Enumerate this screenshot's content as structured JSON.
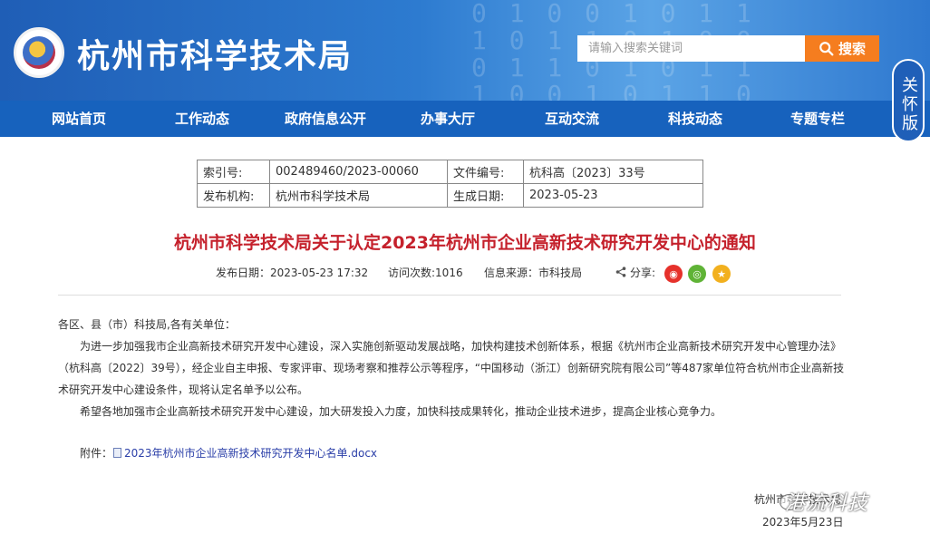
{
  "header": {
    "site_title": "杭州市科学技术局",
    "search_placeholder": "请输入搜索关键词",
    "search_button": "搜索",
    "care_mode": "关怀版"
  },
  "nav": [
    {
      "label": "网站首页"
    },
    {
      "label": "工作动态"
    },
    {
      "label": "政府信息公开"
    },
    {
      "label": "办事大厅"
    },
    {
      "label": "互动交流"
    },
    {
      "label": "科技动态"
    },
    {
      "label": "专题专栏"
    }
  ],
  "info_table": {
    "index_label": "索引号:",
    "index_value": "002489460/2023-00060",
    "doc_no_label": "文件编号:",
    "doc_no_value": "杭科高〔2023〕33号",
    "issuer_label": "发布机构:",
    "issuer_value": "杭州市科学技术局",
    "gen_date_label": "生成日期:",
    "gen_date_value": "2023-05-23"
  },
  "article": {
    "title": "杭州市科学技术局关于认定2023年杭州市企业高新技术研究开发中心的通知",
    "publish_date": "发布日期：2023-05-23 17:32",
    "visits": "访问次数:1016",
    "source": "信息来源：市科技局",
    "share_label": "分享:",
    "salutation": "各区、县（市）科技局,各有关单位：",
    "para1": "为进一步加强我市企业高新技术研究开发中心建设，深入实施创新驱动发展战略，加快构建技术创新体系，根据《杭州市企业高新技术研究开发中心管理办法》（杭科高〔2022〕39号），经企业自主申报、专家评审、现场考察和推荐公示等程序，“中国移动（浙江）创新研究院有限公司”等487家单位符合杭州市企业高新技术研究开发中心建设条件，现将认定名单予以公布。",
    "para2": "希望各地加强市企业高新技术研究开发中心建设，加大研发投入力度，加快科技成果转化，推动企业技术进步，提高企业核心竞争力。",
    "attachment_label": "附件：",
    "attachment_link": "2023年杭州市企业高新技术研究开发中心名单.docx",
    "signature": "杭州市科学技术局",
    "sign_date": "2023年5月23日",
    "watermark": "港流科技"
  },
  "colors": {
    "header_blue": "#1b5fb8",
    "nav_blue": "#1762bd",
    "search_orange": "#f57d1f",
    "title_red": "#c5212c",
    "weibo_red": "#e6312b",
    "wechat_green": "#5fb336",
    "qzone_yellow": "#f2b01e"
  }
}
